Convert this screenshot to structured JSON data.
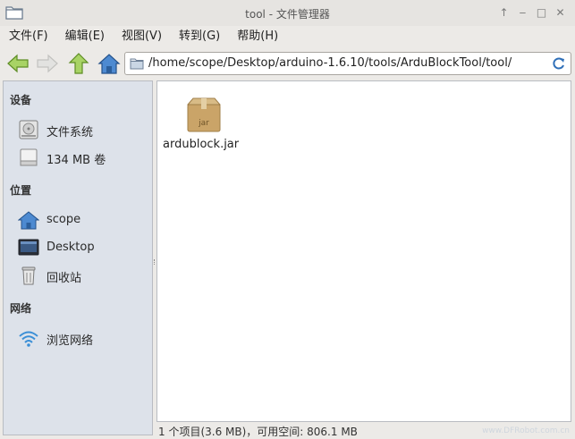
{
  "window": {
    "title": "tool - 文件管理器",
    "controls": {
      "up": "↑",
      "minimize": "‒",
      "maximize": "□",
      "close": "✕"
    }
  },
  "menu": [
    "文件(F)",
    "编辑(E)",
    "视图(V)",
    "转到(G)",
    "帮助(H)"
  ],
  "toolbar": {
    "buttons": [
      "back-icon",
      "forward-icon",
      "up-icon",
      "home-icon"
    ],
    "location": "/home/scope/Desktop/arduino-1.6.10/tools/ArduBlockTool/tool/"
  },
  "sidebar": {
    "devices_header": "设备",
    "devices": [
      {
        "label": "文件系统",
        "icon": "harddisk-icon"
      },
      {
        "label": "134 MB 卷",
        "icon": "drive-icon"
      }
    ],
    "places_header": "位置",
    "places": [
      {
        "label": "scope",
        "icon": "home-icon"
      },
      {
        "label": "Desktop",
        "icon": "desktop-icon"
      },
      {
        "label": "回收站",
        "icon": "trash-icon"
      }
    ],
    "network_header": "网络",
    "network": [
      {
        "label": "浏览网络",
        "icon": "wifi-icon"
      }
    ]
  },
  "files": [
    {
      "name": "ardublock.jar",
      "icon": "jar-package-icon",
      "badge": "jar"
    }
  ],
  "status": "1 个项目(3.6 MB)，可用空间: 806.1 MB",
  "watermark": "www.DFRobot.com.cn",
  "colors": {
    "sidebar_bg": "#dde2ea",
    "nav_green": "#8cc63f",
    "home_blue": "#3f7fc4",
    "package_tan": "#c9a46c"
  }
}
